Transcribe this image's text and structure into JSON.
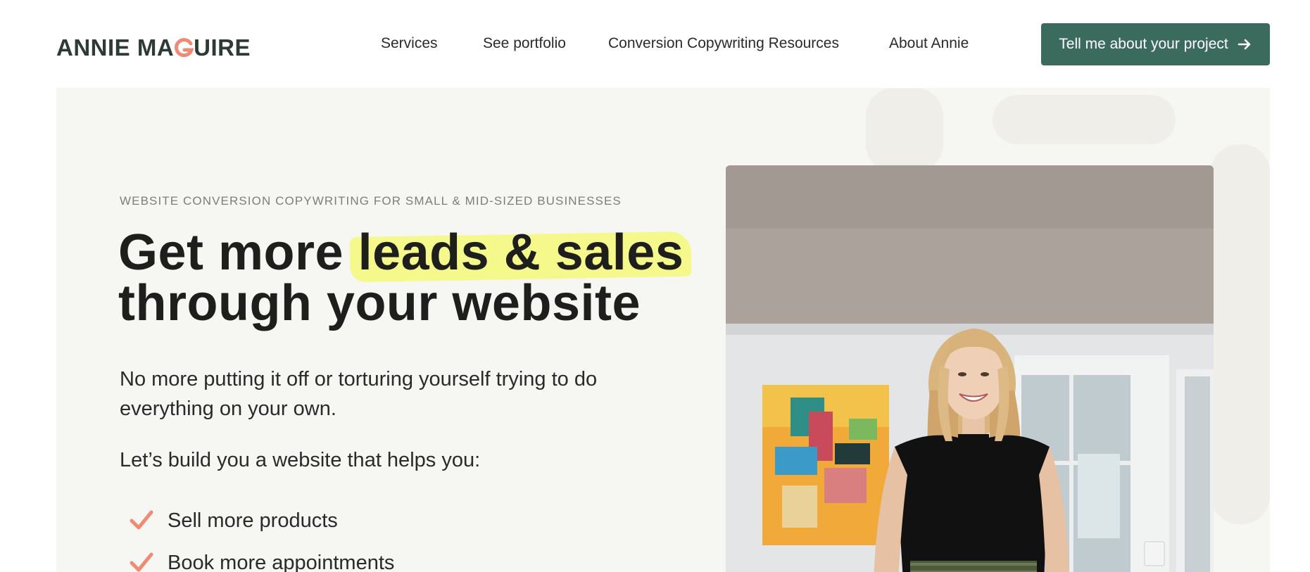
{
  "header": {
    "logo": {
      "part1": "ANNIE MA",
      "part2": "UIRE",
      "g_letter": "G"
    },
    "nav": [
      {
        "label": "Services"
      },
      {
        "label": "See portfolio"
      },
      {
        "label": "Conversion Copywriting Resources"
      },
      {
        "label": "About Annie"
      }
    ],
    "cta": {
      "label": "Tell me about your project",
      "icon": "arrow-right-icon"
    }
  },
  "hero": {
    "eyebrow": "WEBSITE CONVERSION COPYWRITING FOR SMALL & MID-SIZED BUSINESSES",
    "headline": {
      "line1_prefix": "Get more ",
      "line1_highlight": "leads & sales",
      "line2": "through your website"
    },
    "subheadline": "No more putting it off or torturing yourself trying to do everything on your own.",
    "intro": "Let’s build you a website that helps you:",
    "benefits": [
      {
        "label": "Sell more products",
        "icon": "checkmark-icon"
      },
      {
        "label": "Book more appointments",
        "icon": "checkmark-icon"
      }
    ]
  },
  "colors": {
    "brand_green": "#3b6b5c",
    "accent_coral": "#ef8a74",
    "highlight_yellow": "#f5f88a",
    "hero_bg": "#f6f6f3"
  }
}
